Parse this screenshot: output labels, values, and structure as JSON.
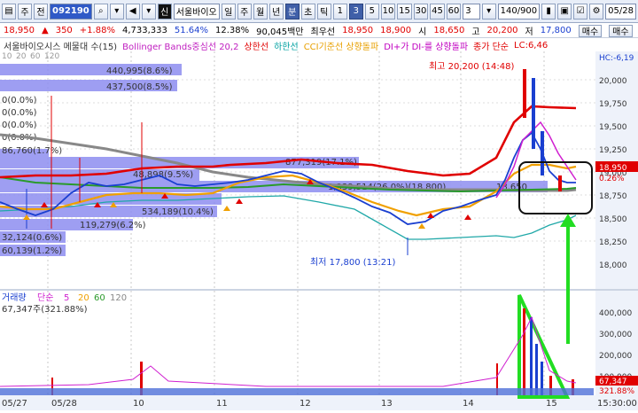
{
  "toolbar": {
    "items": [
      "주",
      "전"
    ],
    "code": "092190",
    "stock_name": "서울바이오",
    "signal": "신",
    "periods": [
      "일",
      "주",
      "월",
      "년",
      "분",
      "초",
      "틱"
    ],
    "active_period": "분",
    "minute_options": [
      "1",
      "3",
      "5",
      "10",
      "15",
      "30",
      "45",
      "60"
    ],
    "active_minute": "3",
    "count_value": "3",
    "range": "140/900",
    "date": "05/28"
  },
  "quote": {
    "price": "18,950",
    "change": "350",
    "change_pct": "+1.88%",
    "volume": "4,733,333",
    "turnover_pct": "51.64%",
    "ratio_pct": "12.38%",
    "trade_amount": "90,045백만",
    "best_ask_label": "최우선",
    "best_ask": "18,950",
    "best_bid": "18,900",
    "open_label": "시",
    "open": "18,650",
    "high_label": "고",
    "high": "20,200",
    "low_label": "저",
    "low": "17,800",
    "sell_label": "매수",
    "buy_label": "매수"
  },
  "legend": {
    "title": "서울바이오시스 메물대 수(15)",
    "bollinger": "Bollinger Bands중심선 20,2",
    "upper": "상한선",
    "lower": "하한선",
    "cci": "CCI기준선 상향돌파",
    "di": "DI+가 DI-를 상향돌파",
    "rise": "종가 단순",
    "extra": "LC:6,46",
    "extra2": "HC:-6,19"
  },
  "price_chart": {
    "y_ticks": [
      "20,000",
      "19,750",
      "19,500",
      "19,250",
      "19,000",
      "18,750",
      "18,500",
      "18,250",
      "18,000"
    ],
    "current_price_label": "18,950",
    "current_pct_label": "0.26%",
    "top_left": [
      "10",
      "20",
      "60",
      "120"
    ],
    "high_annotation": "최고 20,200 (14:48)",
    "low_annotation": "최저 17,800 (13:21)",
    "volume_profile": [
      {
        "label": "440,995(8.6%)"
      },
      {
        "label": "437,500(8.5%)"
      },
      {
        "label": "0(0.0%)"
      },
      {
        "label": "0(0.0%)"
      },
      {
        "label": "0(0.0%)"
      },
      {
        "label": "0(0.0%)"
      },
      {
        "label": "86,760(1.7%)"
      },
      {
        "label": "877,319(17.1%)"
      },
      {
        "label": "48,898(9.5%)"
      },
      {
        "label": "1,339,514(26.0%)(18,800)"
      },
      {
        "label": "18,650"
      },
      {
        "label": "534,189(10.4%)"
      },
      {
        "label": "119,279(6.2%)"
      },
      {
        "label": "32,124(0.6%)"
      },
      {
        "label": "60,139(1.2%)"
      }
    ]
  },
  "volume_chart": {
    "legend_label": "거래량",
    "legend_ma": [
      "단순",
      "5",
      "20",
      "60",
      "120"
    ],
    "info": "67,347주(321.88%)",
    "y_ticks": [
      "400,000",
      "300,000",
      "200,000",
      "100,000"
    ],
    "current_label": "67,347",
    "current_pct": "321.88%"
  },
  "x_axis": {
    "labels": [
      "05/27",
      "05/28",
      "10",
      "11",
      "12",
      "13",
      "14",
      "15"
    ],
    "time_label": "15:30:00"
  },
  "colors": {
    "up": "#e00000",
    "down": "#1a3fd0",
    "accent": "#2f59c7",
    "annotation_green": "#22dd22"
  }
}
